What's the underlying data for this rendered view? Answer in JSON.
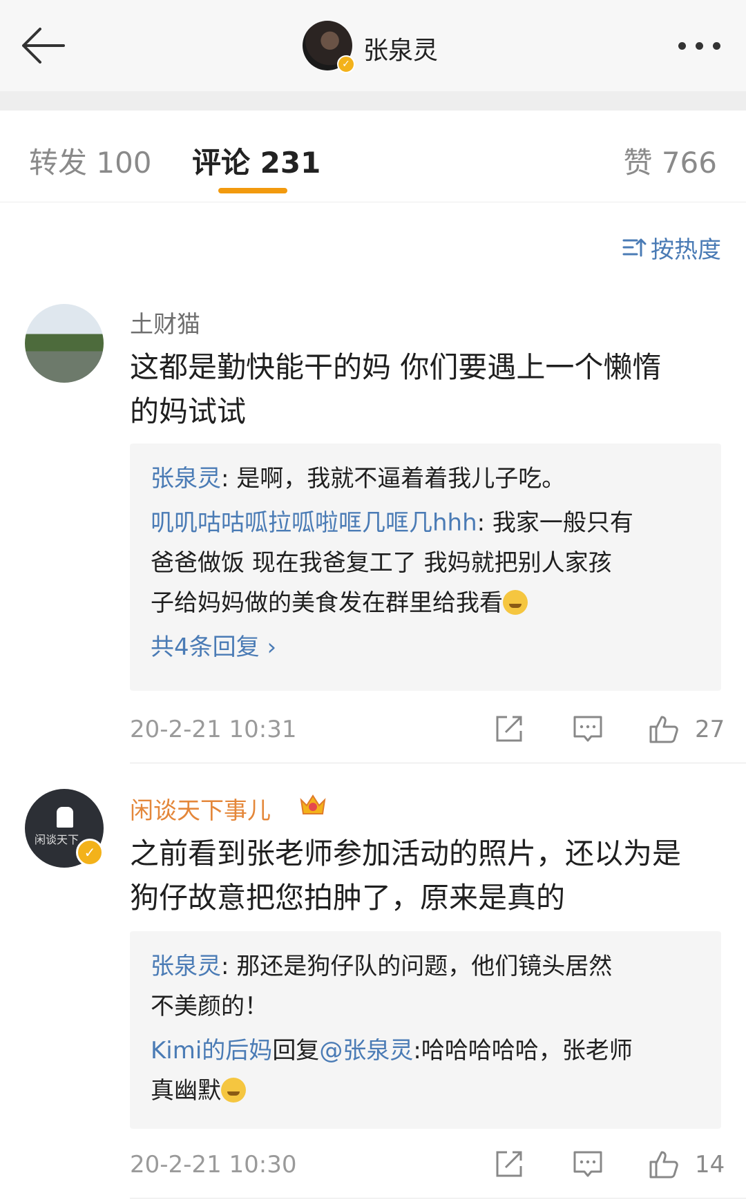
{
  "topbar": {
    "title": "张泉灵",
    "verified_mark": "✓"
  },
  "tabs": [
    {
      "label": "转发 100"
    },
    {
      "label": "评论 231"
    },
    {
      "label": "赞 766"
    }
  ],
  "sort": {
    "label": "按热度"
  },
  "comments": [
    {
      "username": "土财猫",
      "content_lines": [
        "这都是勤快能干的妈 你们要遇上一个懒惰",
        "的妈试试"
      ],
      "replies": [
        {
          "name": "张泉灵",
          "text": ": 是啊，我就不逼着着我儿子吃。"
        },
        {
          "name": "叽叽咕咕呱拉呱啦哐几哐几hhh",
          "text": ": 我家一般只有",
          "cont1": "爸爸做饭 现在我爸复工了 我妈就把别人家孩",
          "cont2": "子给妈妈做的美食发在群里给我看"
        }
      ],
      "more_replies": "共4条回复 ›",
      "timestamp": "20-2-21 10:31",
      "likes": "27"
    },
    {
      "username": "闲谈天下事儿",
      "avatar_text": "闲谈天下",
      "content_lines": [
        "之前看到张老师参加活动的照片，还以为是",
        "狗仔故意把您拍肿了，原来是真的"
      ],
      "replies": [
        {
          "name": "张泉灵",
          "text": ": 那还是狗仔队的问题，他们镜头居然",
          "cont1": "不美颜的！"
        },
        {
          "name": "Kimi的后妈",
          "text": "回复",
          "mention": "@张泉灵",
          "text2": ":哈哈哈哈哈，张老师",
          "cont1": "真幽默"
        }
      ],
      "timestamp": "20-2-21 10:30",
      "likes": "14"
    }
  ],
  "icons": {
    "back": "back-arrow-icon",
    "more": "more-dots-icon",
    "sort": "sort-icon",
    "repost": "repost-icon",
    "comment": "comment-icon",
    "like": "thumbs-up-icon",
    "crown": "crown-icon"
  },
  "colors": {
    "accent_orange": "#f29a0e",
    "link_blue": "#4a7bb5",
    "vip_name": "#e4873a",
    "verified_gold": "#f3b21a"
  }
}
